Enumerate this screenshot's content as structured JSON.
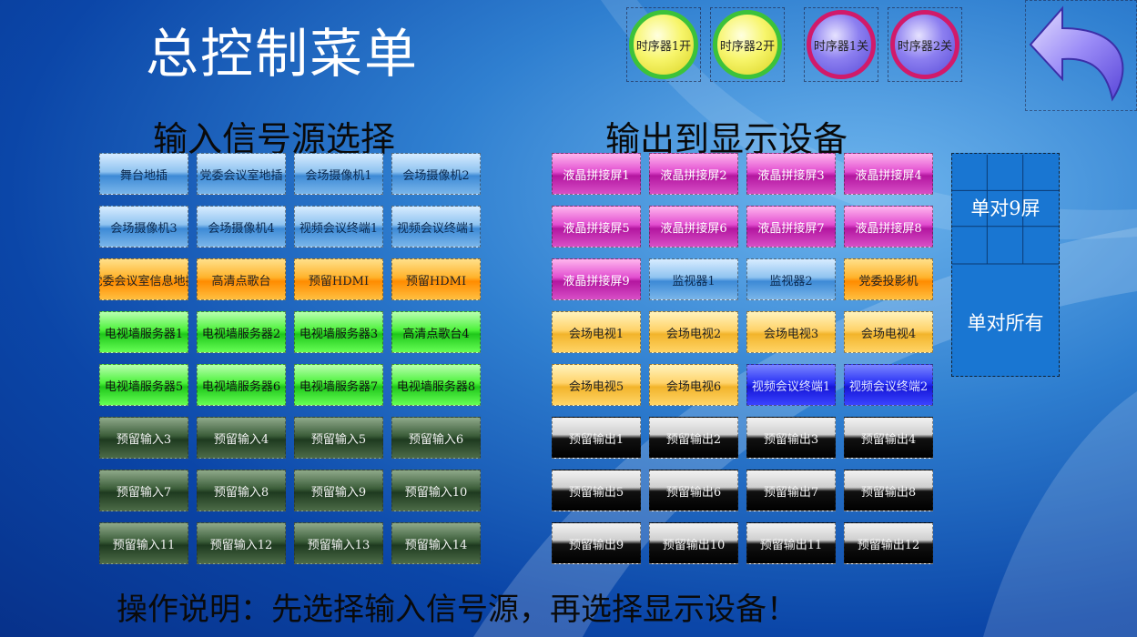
{
  "title": "总控制菜单",
  "sequencers": [
    {
      "label": "时序器1开",
      "style": "yellow"
    },
    {
      "label": "时序器2开",
      "style": "yellow"
    },
    {
      "label": "时序器1关",
      "style": "purple"
    },
    {
      "label": "时序器2关",
      "style": "purple"
    }
  ],
  "input_section": {
    "title": "输入信号源选择",
    "rows": [
      {
        "color": "blue",
        "items": [
          "舞台地插",
          "党委会议室地插",
          "会场摄像机1",
          "会场摄像机2"
        ]
      },
      {
        "color": "blue",
        "items": [
          "会场摄像机3",
          "会场摄像机4",
          "视频会议终端1",
          "视频会议终端1"
        ]
      },
      {
        "color": "orange",
        "items": [
          "党委会议室信息地插",
          "高清点歌台",
          "预留HDMI",
          "预留HDMI"
        ]
      },
      {
        "color": "green",
        "items": [
          "电视墙服务器1",
          "电视墙服务器2",
          "电视墙服务器3",
          "高清点歌台4"
        ]
      },
      {
        "color": "green",
        "items": [
          "电视墙服务器5",
          "电视墙服务器6",
          "电视墙服务器7",
          "电视墙服务器8"
        ]
      },
      {
        "color": "dgreen",
        "items": [
          "预留输入3",
          "预留输入4",
          "预留输入5",
          "预留输入6"
        ]
      },
      {
        "color": "dgreen",
        "items": [
          "预留输入7",
          "预留输入8",
          "预留输入9",
          "预留输入10"
        ]
      },
      {
        "color": "dgreen",
        "items": [
          "预留输入11",
          "预留输入12",
          "预留输入13",
          "预留输入14"
        ]
      }
    ]
  },
  "output_section": {
    "title": "输出到显示设备",
    "rows": [
      {
        "colors": [
          "magenta",
          "magenta",
          "magenta",
          "magenta"
        ],
        "items": [
          "液晶拼接屏1",
          "液晶拼接屏2",
          "液晶拼接屏3",
          "液晶拼接屏4"
        ]
      },
      {
        "colors": [
          "magenta",
          "magenta",
          "magenta",
          "magenta"
        ],
        "items": [
          "液晶拼接屏5",
          "液晶拼接屏6",
          "液晶拼接屏7",
          "液晶拼接屏8"
        ]
      },
      {
        "colors": [
          "magenta",
          "blue",
          "blue",
          "orange"
        ],
        "items": [
          "液晶拼接屏9",
          "监视器1",
          "监视器2",
          "党委投影机"
        ]
      },
      {
        "colors": [
          "gold",
          "gold",
          "gold",
          "gold"
        ],
        "items": [
          "会场电视1",
          "会场电视2",
          "会场电视3",
          "会场电视4"
        ]
      },
      {
        "colors": [
          "gold",
          "gold",
          "vblue",
          "vblue"
        ],
        "items": [
          "会场电视5",
          "会场电视6",
          "视频会议终端1",
          "视频会议终端2"
        ]
      },
      {
        "colors": [
          "black",
          "black",
          "black",
          "black"
        ],
        "items": [
          "预留输出1",
          "预留输出2",
          "预留输出3",
          "预留输出4"
        ]
      },
      {
        "colors": [
          "black",
          "black",
          "black",
          "black"
        ],
        "items": [
          "预留输出5",
          "预留输出6",
          "预留输出7",
          "预留输出8"
        ]
      },
      {
        "colors": [
          "black",
          "black",
          "black",
          "black"
        ],
        "items": [
          "预留输出9",
          "预留输出10",
          "预留输出11",
          "预留输出12"
        ]
      }
    ]
  },
  "panel": {
    "single_9": "单对9屏",
    "single_all": "单对所有"
  },
  "instruction": "操作说明：先选择输入信号源，再选择显示设备！",
  "back_icon": "back-arrow-icon",
  "colors": {
    "bg_dark": "#07318a",
    "bg_light": "#6fb6ee",
    "panel": "#1976d2",
    "arrow": "#9b8cf7"
  }
}
